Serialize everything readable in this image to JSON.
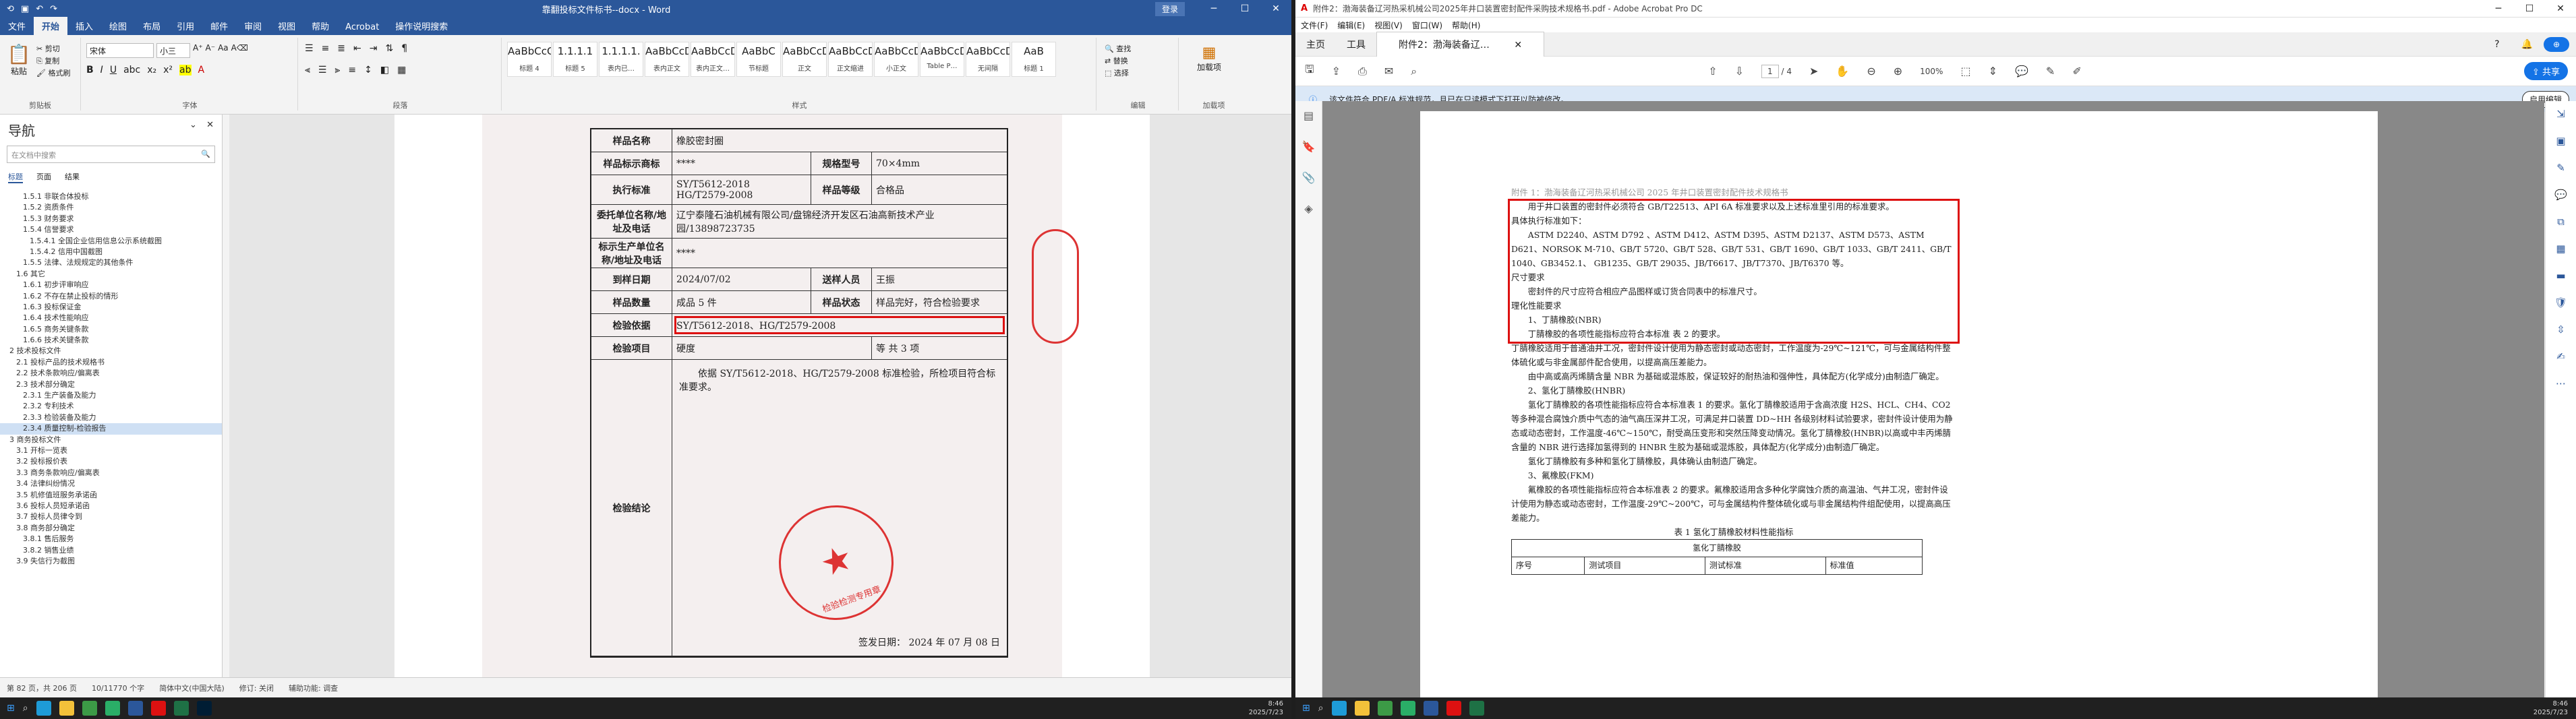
{
  "word": {
    "title": "靠翻投标文件标书--docx  -  Word",
    "login_label": "登录",
    "tabs": [
      "文件",
      "开始",
      "插入",
      "绘图",
      "布局",
      "引用",
      "邮件",
      "审阅",
      "视图",
      "帮助",
      "Acrobat",
      "操作说明搜索"
    ],
    "active_tab": "开始",
    "ribbon": {
      "clipboard_label": "剪贴板",
      "paste": "粘贴",
      "cut": "剪切",
      "copy": "复制",
      "format_painter": "格式刷",
      "font_label": "字体",
      "font_name": "宋体",
      "font_size": "小三",
      "paragraph_label": "段落",
      "styles_label": "样式",
      "editing_label": "编辑",
      "find": "查找",
      "replace": "替换",
      "select": "选择",
      "acrobat_label": "加载项",
      "addin": "加载项",
      "styles": [
        {
          "sample": "AaBbCcC",
          "name": "标题 4"
        },
        {
          "sample": "1.1.1.1",
          "name": "标题 5"
        },
        {
          "sample": "1.1.1.1.",
          "name": "表内已…"
        },
        {
          "sample": "AaBbCcDd",
          "name": "表内正文"
        },
        {
          "sample": "AaBbCcDd",
          "name": "表内正文…"
        },
        {
          "sample": "AaBbC",
          "name": "节标题"
        },
        {
          "sample": "AaBbCcDd",
          "name": "正文"
        },
        {
          "sample": "AaBbCcDd",
          "name": "正文缩进"
        },
        {
          "sample": "AaBbCcDd",
          "name": "小正文"
        },
        {
          "sample": "AaBbCcDd",
          "name": "Table P…"
        },
        {
          "sample": "AaBbCcDd",
          "name": "无间隔"
        },
        {
          "sample": "AaB",
          "name": "标题 1"
        }
      ]
    },
    "nav": {
      "title": "导航",
      "search_placeholder": "在文档中搜索",
      "tabs": [
        "标题",
        "页面",
        "结果"
      ],
      "items": [
        "1.5.1 非联合体投标",
        "1.5.2 资质条件",
        "1.5.3 财务要求",
        "1.5.4 信誉要求",
        "1.5.4.1 全国企业信用信息公示系统截图",
        "1.5.4.2 信用中国截图",
        "1.5.5 法律、法规规定的其他条件",
        "1.6 其它",
        "1.6.1 初步评审响应",
        "1.6.2 不存在禁止投标的情形",
        "1.6.3 投标保证金",
        "1.6.4 技术性能响应",
        "1.6.5 商务关键条款",
        "1.6.6 技术关键条款",
        "2 技术投标文件",
        "2.1 投标产品的技术规格书",
        "2.2 技术条款响应/偏离表",
        "2.3 技术部分确定",
        "2.3.1 生产装备及能力",
        "2.3.2 专利技术",
        "2.3.3 检验装备及能力",
        "2.3.4 质量控制-检验报告",
        "3 商务投标文件",
        "3.1 开标一览表",
        "3.2 投标报价表",
        "3.3 商务条款响应/偏离表",
        "3.4 法律纠纷情况",
        "3.5 机修值班服务承诺函",
        "3.6 投标人员短承诺函",
        "3.7 投标人员律令到",
        "3.8 商务部分确定",
        "3.8.1 售后服务",
        "3.8.2 销售业绩",
        "3.9 失信行为截图"
      ],
      "selected": "2.3.4 质量控制-检验报告"
    },
    "cert": {
      "rows": [
        {
          "label": "样品名称",
          "value": "橡胶密封圈",
          "label2": "",
          "value2": ""
        },
        {
          "label": "样品标示商标",
          "value": "****",
          "label2": "规格型号",
          "value2": "70×4mm"
        },
        {
          "label": "执行标准",
          "value": "SY/T5612-2018\nHG/T2579-2008",
          "label2": "样品等级",
          "value2": "合格品"
        },
        {
          "label": "委托单位名称/地址及电话",
          "value": "辽宁泰隆石油机械有限公司/盘锦经济开发区石油高新技术产业园/13898723735",
          "label2": "",
          "value2": ""
        },
        {
          "label": "标示生产单位名称/地址及电话",
          "value": "****",
          "label2": "",
          "value2": ""
        },
        {
          "label": "到样日期",
          "value": "2024/07/02",
          "label2": "送样人员",
          "value2": "王振"
        },
        {
          "label": "样品数量",
          "value": "成品 5 件",
          "label2": "样品状态",
          "value2": "样品完好，符合检验要求"
        },
        {
          "label": "检验依据",
          "value": "SY/T5612-2018、HG/T2579-2008",
          "label2": "",
          "value2": ""
        },
        {
          "label": "检验项目",
          "value": "硬度",
          "label2": "",
          "value2": "等  共 3 项"
        }
      ],
      "conclusion_label": "检验结论",
      "conclusion_text": "依据 SY/T5612-2018、HG/T2579-2008 标准检验，所检项目符合标准要求。",
      "sign_date": "签发日期：  2024 年 07 月 08 日",
      "stamp_text": "检验检测专用章"
    },
    "status": {
      "page": "第 82 页，共 206 页",
      "words": "10/11770 个字",
      "lang": "简体中文(中国大陆)",
      "track": "修订: 关闭",
      "accessibility": "辅助功能: 调查"
    }
  },
  "acrobat": {
    "title": "附件2：渤海装备辽河热采机械公司2025年井口装置密封配件采购技术规格书.pdf - Adobe Acrobat Pro DC",
    "menu": [
      "文件(F)",
      "编辑(E)",
      "视图(V)",
      "窗口(W)",
      "帮助(H)"
    ],
    "tabs": [
      "主页",
      "工具",
      "附件2：渤海装备辽…"
    ],
    "share_label": "共享",
    "page_current": "1",
    "page_total": "/ 4",
    "zoom": "100%",
    "notice": "该文件符合 PDF/A 标准规范，且已在只读模式下打开以防被修改。",
    "notice_button": "启用编辑",
    "doc": {
      "heading": "附件 1：渤海装备辽河热采机械公司 2025 年井口装置密封配件技术规格书",
      "p1": "用于井口装置的密封件必须符合 GB/T22513、API 6A 标准要求以及上述标准里引用的标准要求。",
      "p2": "具体执行标准如下：",
      "p3": "ASTM D2240、ASTM D792 、ASTM D412、ASTM D395、ASTM D2137、ASTM D573、ASTM D621、NORSOK M-710、GB/T 5720、GB/T 528、GB/T 531、GB/T 1690、GB/T 1033、GB/T 2411、GB/T 1040、GB3452.1、 GB1235、GB/T 29035、JB/T6617、JB/T7370、JB/T6370 等。",
      "p4": "尺寸要求",
      "p5": "密封件的尺寸应符合相应产品图样或订货合同表中的标准尺寸。",
      "p6": "理化性能要求",
      "p7": "1、丁腈橡胶(NBR)",
      "p8": "丁腈橡胶的各项性能指标应符合本标准 表 2 的要求。",
      "p9": "丁腈橡胶适用于普通油井工况，密封件设计使用为静态密封或动态密封，工作温度为-29℃~121℃，可与金属结构件整体硫化或与非金属部件配合使用，以提高高压差能力。",
      "p10": "由中高或高丙烯腈含量 NBR 为基础或混炼胶，保证较好的耐热油和强伸性，具体配方(化学成分)由制造厂确定。",
      "p11": "2、氢化丁腈橡胶(HNBR)",
      "p12": "氢化丁腈橡胶的各项性能指标应符合本标准表 1 的要求。氢化丁腈橡胶适用于含高浓度 H2S、HCL、CH4、CO2 等多种混合腐蚀介质中气态的油气高压深井工况，可满足井口装置 DD~HH 各级别材料试验要求，密封件设计使用为静态或动态密封，工作温度-46℃~150℃，耐受高压变形和突然压降变动情况。氢化丁腈橡胶(HNBR)以高或中丰丙烯腈含量的 NBR 进行选择加氢得到的 HNBR 生胶为基础或混炼胶，具体配方(化学成分)由制造厂确定。",
      "p13": "氢化丁腈橡胶有多种和氢化丁腈橡胶，具体确认由制造厂确定。",
      "p14": "3、氟橡胶(FKM)",
      "p15": "氟橡胶的各项性能指标应符合本标准表 2 的要求。氟橡胶适用含多种化学腐蚀介质的高温油、气井工况，密封件设计使用为静态或动态密封，工作温度-29℃~200℃，可与金属结构件整体硫化或与非金属结构件组配使用，以提高高压差能力。",
      "p16": "表 1 氢化丁腈橡胶材料性能指标",
      "table_title": "氢化丁腈橡胶",
      "table_head": [
        "序号",
        "测试项目",
        "测试标准",
        "标准值"
      ]
    }
  },
  "taskbar": {
    "time1": "8:46",
    "date1": "2025/7/23",
    "time2": "8:46",
    "date2": "2025/7/23"
  }
}
